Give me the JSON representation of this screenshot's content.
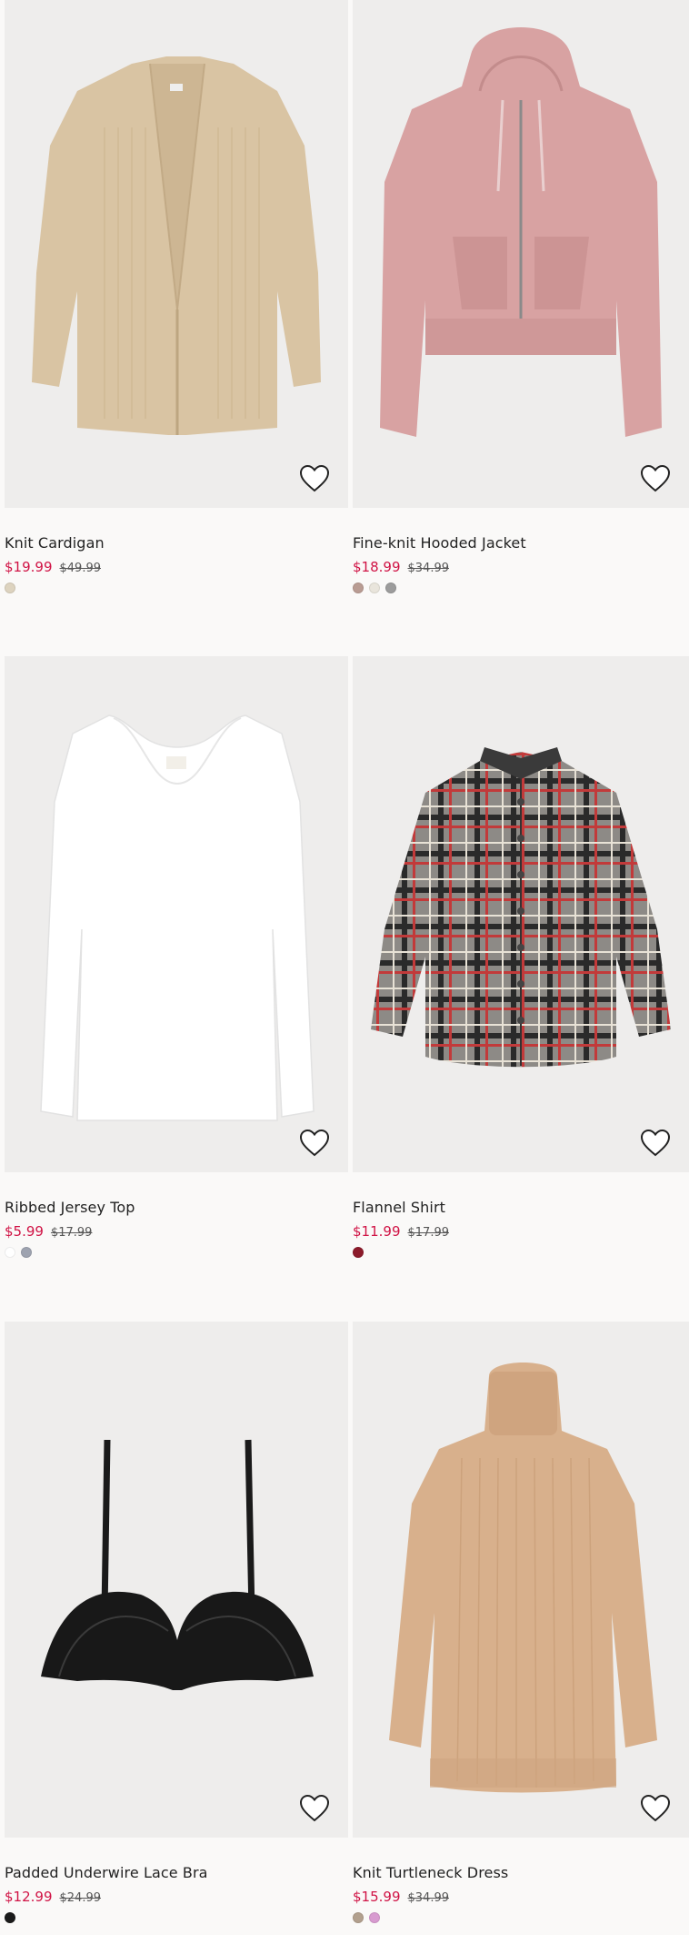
{
  "products": [
    {
      "title": "Knit Cardigan",
      "sale_price": "$19.99",
      "regular_price": "$49.99",
      "image": "beige-knit-cardigan",
      "swatches": [
        "#ddd3bf"
      ]
    },
    {
      "title": "Fine-knit Hooded Jacket",
      "sale_price": "$18.99",
      "regular_price": "$34.99",
      "image": "pink-knit-hooded-jacket",
      "swatches": [
        "#b99c93",
        "#e9e5dc",
        "#9c9c9c"
      ]
    },
    {
      "title": "Ribbed Jersey Top",
      "sale_price": "$5.99",
      "regular_price": "$17.99",
      "image": "white-long-sleeve-top",
      "swatches": [
        "#ffffff",
        "#9ea3b0"
      ]
    },
    {
      "title": "Flannel Shirt",
      "sale_price": "$11.99",
      "regular_price": "$17.99",
      "image": "gray-plaid-flannel-shirt",
      "swatches": [
        "#8c1b2b"
      ]
    },
    {
      "title": "Padded Underwire Lace Bra",
      "sale_price": "$12.99",
      "regular_price": "$24.99",
      "image": "black-lace-bra",
      "swatches": [
        "#1a1a1a"
      ]
    },
    {
      "title": "Knit Turtleneck Dress",
      "sale_price": "$15.99",
      "regular_price": "$34.99",
      "image": "beige-turtleneck-dress",
      "swatches": [
        "#b2a08e",
        "#d89bd0"
      ]
    }
  ],
  "colors": {
    "sale": "#d01345",
    "background": "#faf9f8",
    "image_bg": "#eeedec"
  },
  "icons": {
    "favorite": "heart-outline-icon"
  }
}
